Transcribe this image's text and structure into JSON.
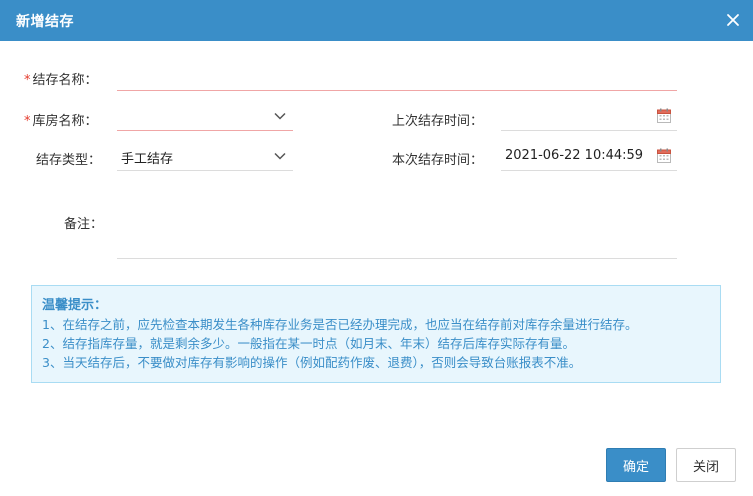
{
  "dialog": {
    "title": "新增结存",
    "close_icon": "close-icon"
  },
  "form": {
    "required_mark": "*",
    "store_name": {
      "label": "结存名称：",
      "value": ""
    },
    "warehouse": {
      "label": "库房名称：",
      "value": ""
    },
    "last_time": {
      "label": "上次结存时间：",
      "value": ""
    },
    "store_type": {
      "label": "结存类型：",
      "value": "手工结存"
    },
    "this_time": {
      "label": "本次结存时间：",
      "value": "2021-06-22 10:44:59"
    },
    "remark": {
      "label": "备注：",
      "value": ""
    }
  },
  "tips": {
    "title": "温馨提示：",
    "lines": [
      "1、在结存之前，应先检查本期发生各种库存业务是否已经办理完成，也应当在结存前对库存余量进行结存。",
      "2、结存指库存量，就是剩余多少。一般指在某一时点（如月末、年末）结存后库存实际存有量。",
      "3、当天结存后，不要做对库存有影响的操作（例如配药作废、退费），否则会导致台账报表不准。"
    ]
  },
  "buttons": {
    "confirm": "确定",
    "close": "关闭"
  },
  "colors": {
    "accent": "#3a8ec8",
    "required": "#e4392b",
    "tip_bg": "#e8f6fd",
    "tip_border": "#a9dcf3"
  }
}
